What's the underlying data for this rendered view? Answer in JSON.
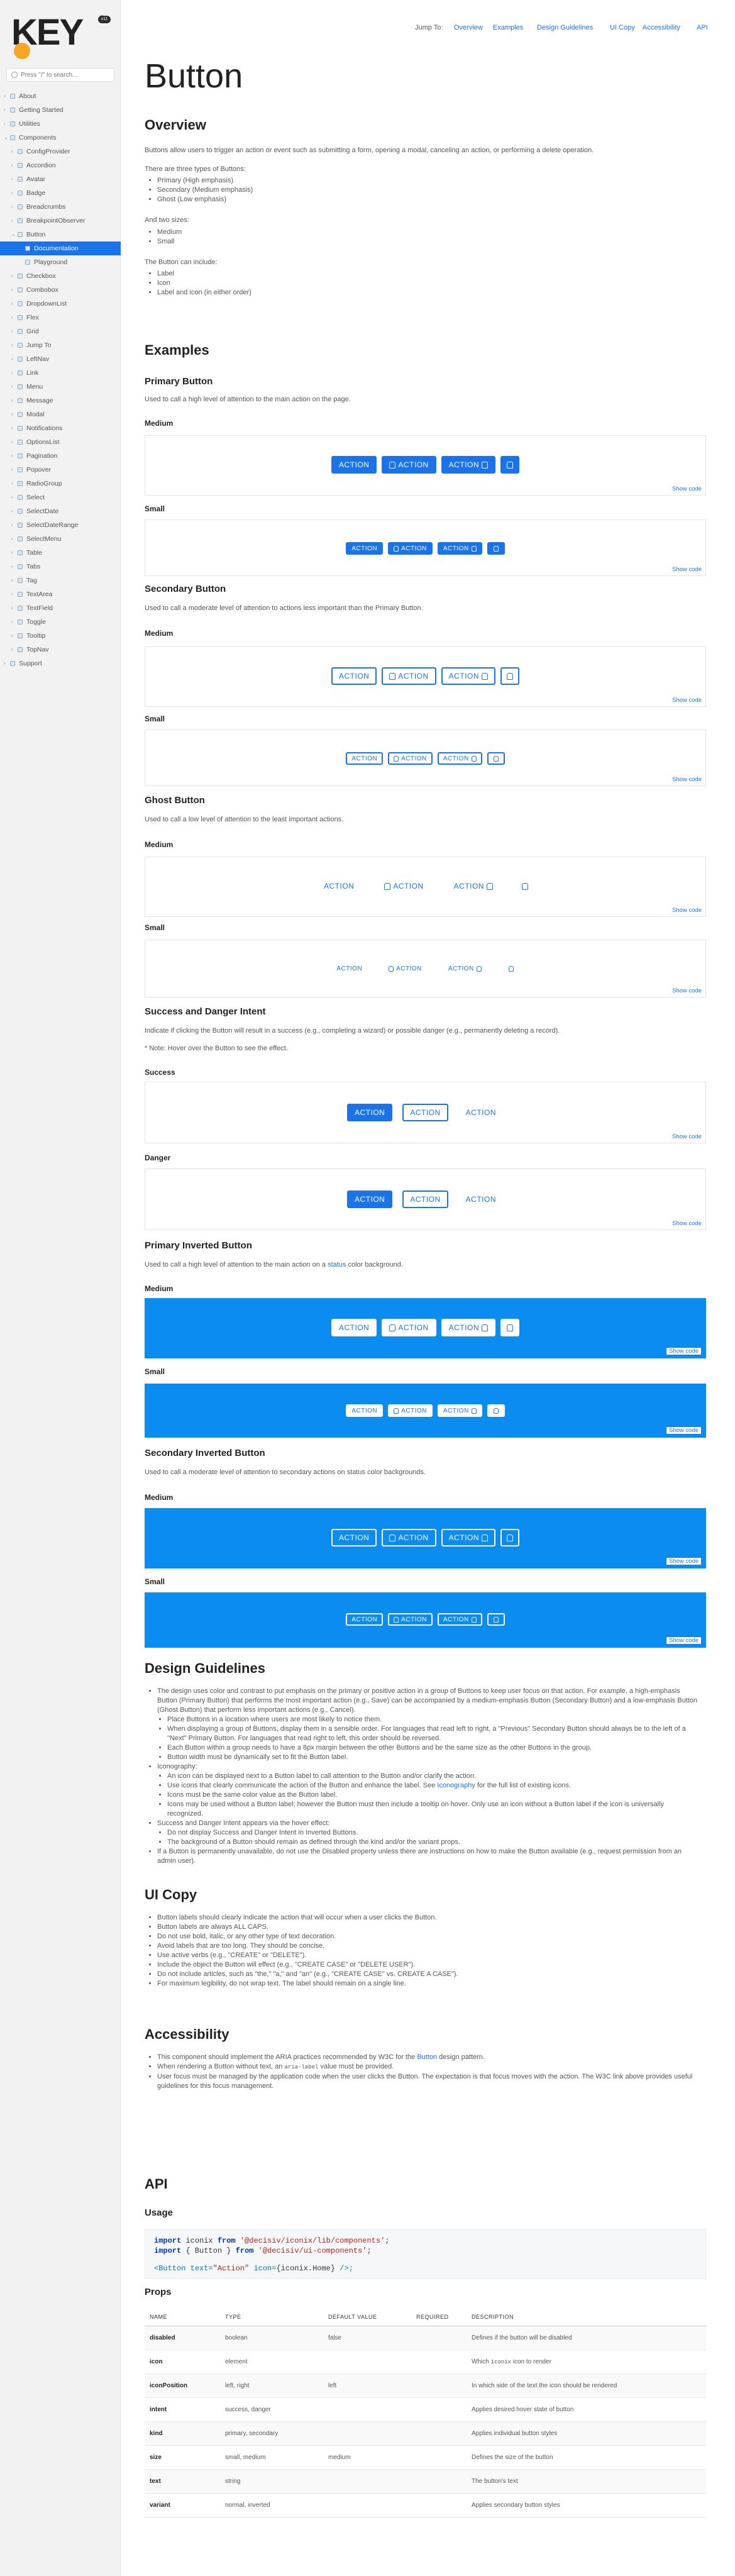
{
  "brand": {
    "logo_text": "KEY",
    "version_badge": "v11"
  },
  "search": {
    "placeholder": "Press \"/\" to search..."
  },
  "sidebar": {
    "items": [
      {
        "label": "About",
        "level": 0,
        "arrow": "›"
      },
      {
        "label": "Getting Started",
        "level": 0,
        "arrow": "›"
      },
      {
        "label": "Utilities",
        "level": 0,
        "arrow": "›"
      },
      {
        "label": "Components",
        "level": 0,
        "arrow": "⌄"
      },
      {
        "label": "ConfigProvider",
        "level": 1,
        "arrow": "›"
      },
      {
        "label": "Accordion",
        "level": 1,
        "arrow": "›"
      },
      {
        "label": "Avatar",
        "level": 1,
        "arrow": "›"
      },
      {
        "label": "Badge",
        "level": 1,
        "arrow": "›"
      },
      {
        "label": "Breadcrumbs",
        "level": 1,
        "arrow": "›"
      },
      {
        "label": "BreakpointObserver",
        "level": 1,
        "arrow": "›"
      },
      {
        "label": "Button",
        "level": 1,
        "arrow": "⌄"
      },
      {
        "label": "Documentation",
        "level": 2,
        "arrow": "",
        "active": true
      },
      {
        "label": "Playground",
        "level": 2,
        "arrow": ""
      },
      {
        "label": "Checkbox",
        "level": 1,
        "arrow": "›"
      },
      {
        "label": "Combobox",
        "level": 1,
        "arrow": "›"
      },
      {
        "label": "DropdownList",
        "level": 1,
        "arrow": "›"
      },
      {
        "label": "Flex",
        "level": 1,
        "arrow": "›"
      },
      {
        "label": "Grid",
        "level": 1,
        "arrow": "›"
      },
      {
        "label": "Jump To",
        "level": 1,
        "arrow": "›"
      },
      {
        "label": "LeftNav",
        "level": 1,
        "arrow": "›"
      },
      {
        "label": "Link",
        "level": 1,
        "arrow": "›"
      },
      {
        "label": "Menu",
        "level": 1,
        "arrow": "›"
      },
      {
        "label": "Message",
        "level": 1,
        "arrow": "›"
      },
      {
        "label": "Modal",
        "level": 1,
        "arrow": "›"
      },
      {
        "label": "Notifications",
        "level": 1,
        "arrow": "›"
      },
      {
        "label": "OptionsList",
        "level": 1,
        "arrow": "›"
      },
      {
        "label": "Pagination",
        "level": 1,
        "arrow": "›"
      },
      {
        "label": "Popover",
        "level": 1,
        "arrow": "›"
      },
      {
        "label": "RadioGroup",
        "level": 1,
        "arrow": "›"
      },
      {
        "label": "Select",
        "level": 1,
        "arrow": "›"
      },
      {
        "label": "SelectDate",
        "level": 1,
        "arrow": "›"
      },
      {
        "label": "SelectDateRange",
        "level": 1,
        "arrow": "›"
      },
      {
        "label": "SelectMenu",
        "level": 1,
        "arrow": "›"
      },
      {
        "label": "Table",
        "level": 1,
        "arrow": "›"
      },
      {
        "label": "Tabs",
        "level": 1,
        "arrow": "›"
      },
      {
        "label": "Tag",
        "level": 1,
        "arrow": "›"
      },
      {
        "label": "TextArea",
        "level": 1,
        "arrow": "›"
      },
      {
        "label": "TextField",
        "level": 1,
        "arrow": "›"
      },
      {
        "label": "Toggle",
        "level": 1,
        "arrow": "›"
      },
      {
        "label": "Tooltip",
        "level": 1,
        "arrow": "›"
      },
      {
        "label": "TopNav",
        "level": 1,
        "arrow": "›"
      },
      {
        "label": "Support",
        "level": 0,
        "arrow": "›"
      }
    ]
  },
  "jump": {
    "label": "Jump To:",
    "links": [
      "Overview",
      "Examples",
      "Design Guidelines",
      "UI Copy",
      "Accessibility",
      "API"
    ]
  },
  "page": {
    "title": "Button"
  },
  "overview": {
    "heading": "Overview",
    "intro": "Buttons allow users to trigger an action or event such as submitting a form, opening a modal, canceling an action, or performing a delete operation.",
    "types_intro": "There are three types of Buttons:",
    "types": [
      "Primary (High emphasis)",
      "Secondary (Medium emphasis)",
      "Ghost (Low emphasis)"
    ],
    "sizes_intro": "And two sizes:",
    "sizes": [
      "Medium",
      "Small"
    ],
    "include_intro": "The Button can include:",
    "include": [
      "Label",
      "Icon",
      "Label and icon (in either order)"
    ]
  },
  "examples": {
    "heading": "Examples",
    "button_label": "ACTION",
    "show_code": "Show code",
    "medium": "Medium",
    "small": "Small",
    "primary": {
      "title": "Primary Button",
      "desc": "Used to call a high level of attention to the main action on the page."
    },
    "secondary": {
      "title": "Secondary Button",
      "desc": "Used to call a moderate level of attention to actions less important than the Primary Button."
    },
    "ghost": {
      "title": "Ghost Button",
      "desc": "Used to call a low level of attention to the least important actions."
    },
    "intent": {
      "title": "Success and Danger Intent",
      "desc": "Indicate if clicking the Button will result in a success (e.g., completing a wizard) or possible danger (e.g., permanently deleting a record).",
      "note": "* Note: Hover over the Button to see the effect.",
      "success": "Success",
      "danger": "Danger"
    },
    "pinv": {
      "title": "Primary Inverted Button",
      "desc_before": "Used to call a high level of attention to the main action on a ",
      "desc_link": "status",
      "desc_after": " color background."
    },
    "sinv": {
      "title": "Secondary Inverted Button",
      "desc": "Used to call a moderate level of attention to secondary actions on status color backgrounds."
    }
  },
  "guidelines": {
    "heading": "Design Guidelines",
    "p1": "The design uses color and contrast to put emphasis on the primary or positive action in a group of Buttons to keep user focus on that action. For example, a high-emphasis Button (Primary Button) that performs the most important action (e.g., Save) can be accompanied by a medium-emphasis Button (Secondary Button) and a low-emphasis Button (Ghost Button) that perform less important actions (e.g., Cancel).",
    "p1_sub": [
      "Place Buttons in a location where users are most likely to notice them.",
      "When displaying a group of Buttons, display them in a sensible order. For languages that read left to right, a \"Previous\" Secondary Button should always be to the left of a \"Next\" Primary Button. For languages that read right to left, this order should be reversed.",
      "Each Button within a group needs to have a 8px margin between the other Buttons and be the same size as the other Buttons in the group.",
      "Button width must be dynamically set to fit the Button label."
    ],
    "p2": "Iconography:",
    "p2_sub_a": "An icon can be displayed next to a Button label to call attention to the Button and/or clarify the action.",
    "p2_sub_b_before": "Use icons that clearly communicate the action of the Button and enhance the label. See ",
    "p2_sub_b_link": "Iconography",
    "p2_sub_b_after": " for the full list of existing icons.",
    "p2_sub_c": [
      "Icons must be the same color value as the Button label.",
      "Icons may be used without a Button label; however the Button must then include a tooltip on hover. Only use an icon without a Button label if the icon is universally recognized."
    ],
    "p3": "Success and Danger Intent appears via the hover effect:",
    "p3_sub": [
      "Do not display Success and Danger Intent in Inverted Buttons.",
      "The background of a Button should remain as defined through the kind and/or the variant props."
    ],
    "p4": "If a Button is permanently unavailable, do not use the Disabled property unless there are instructions on how to make the Button available (e.g., request permission from an admin user)."
  },
  "uicopy": {
    "heading": "UI Copy",
    "items": [
      "Button labels should clearly indicate the action that will occur when a user clicks the Button.",
      "Button labels are always ALL CAPS.",
      "Do not use bold, italic, or any other type of text decoration.",
      "Avoid labels that are too long. They should be concise.",
      "Use active verbs (e.g., \"CREATE\" or \"DELETE\").",
      "Include the object the Button will effect (e.g., \"CREATE CASE\" or \"DELETE USER\").",
      "Do not include articles, such as \"the,\" \"a,\" and \"an\" (e.g., \"CREATE CASE\" vs. CREATE A CASE\").",
      "For maximum legibility, do not wrap text. The label should remain on a single line."
    ]
  },
  "a11y": {
    "heading": "Accessibility",
    "i1_before": "This component should implement the ARIA practices recommended by W3C for the ",
    "i1_link": "Button",
    "i1_after": " design pattern.",
    "i2_before": "When rendering a Button without text, an ",
    "i2_code": "aria-label",
    "i2_after": " value must be provided.",
    "i3": "User focus must be managed by the application code when the user clicks the Button. The expectation is that focus moves with the action. The W3C link above provides useful guidelines for this focus management."
  },
  "api": {
    "heading": "API",
    "usage": "Usage",
    "code": {
      "l1_kw": "import",
      "l1_a": " iconix ",
      "l1_from": "from",
      "l1_str": " '@decisiv/iconix/lib/components'",
      "l1_end": ";",
      "l2_kw": "import",
      "l2_a": " { Button } ",
      "l2_from": "from",
      "l2_str": " '@decisiv/ui-components'",
      "l2_end": ";",
      "l3_tag": "<Button",
      "l3_attr": " text=",
      "l3_str": "\"Action\"",
      "l3_attr2": " icon=",
      "l3_val": "{iconix.Home}",
      "l3_end": " />;"
    },
    "props_heading": "Props",
    "columns": [
      "NAME",
      "TYPE",
      "DEFAULT VALUE",
      "REQUIRED",
      "DESCRIPTION"
    ],
    "rows": [
      {
        "name": "disabled",
        "type": "boolean",
        "default": "false",
        "required": "",
        "desc": "Defines if the button will be disabled"
      },
      {
        "name": "icon",
        "type": "element",
        "default": "",
        "required": "",
        "desc_before": "Which ",
        "desc_code": "iconix",
        "desc_after": " icon to render"
      },
      {
        "name": "iconPosition",
        "type": "left, right",
        "default": "left",
        "required": "",
        "desc": "In which side of the text the icon should be rendered"
      },
      {
        "name": "intent",
        "type": "success, danger",
        "default": "",
        "required": "",
        "desc": "Applies desired hover state of button"
      },
      {
        "name": "kind",
        "type": "primary, secondary",
        "default": "",
        "required": "",
        "desc": "Applies individual button styles"
      },
      {
        "name": "size",
        "type": "small, medium",
        "default": "medium",
        "required": "",
        "desc": "Defines the size of the button"
      },
      {
        "name": "text",
        "type": "string",
        "default": "",
        "required": "",
        "desc": "The button's text"
      },
      {
        "name": "variant",
        "type": "normal, inverted",
        "default": "",
        "required": "",
        "desc": "Applies secondary button styles"
      }
    ]
  },
  "colors": {
    "primary": "#1a73e8",
    "inverted_bg": "#0a8cf0",
    "active_nav": "#1a73e8"
  },
  "icons": [
    "search-icon",
    "home-icon",
    "chevron-right-icon",
    "chevron-down-icon",
    "component-box-icon"
  ]
}
